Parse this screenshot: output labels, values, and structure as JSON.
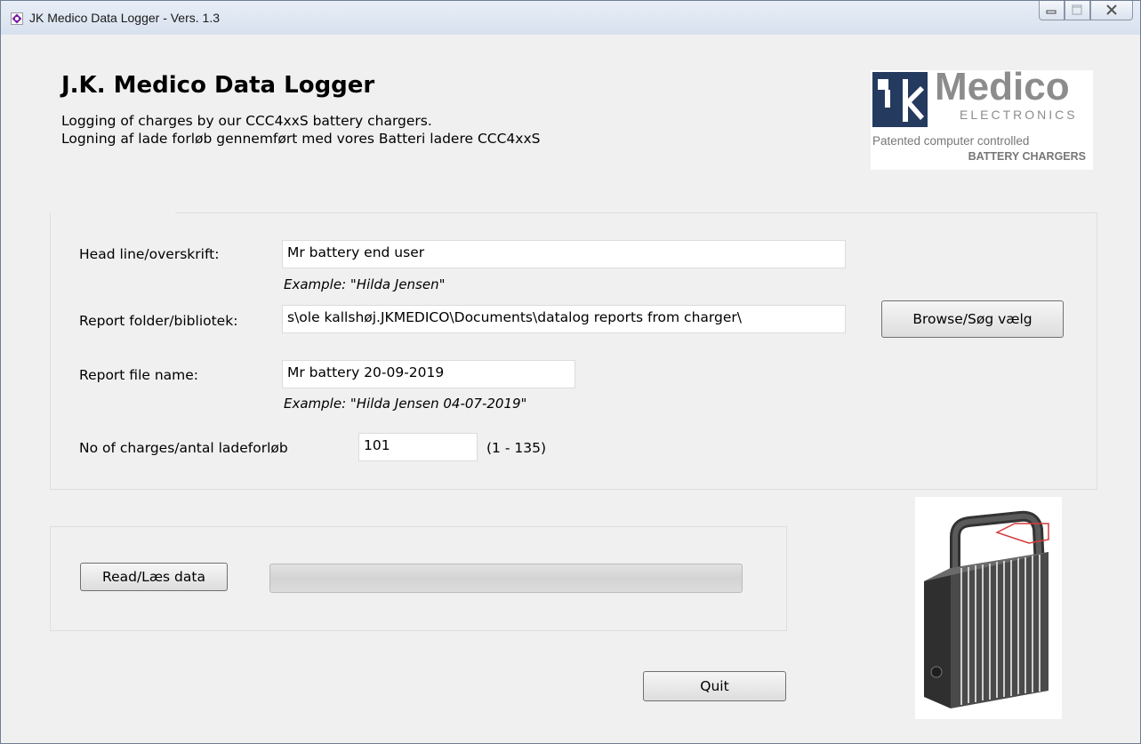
{
  "window": {
    "title": "JK Medico Data Logger - Vers. 1.3"
  },
  "header": {
    "title": "J.K. Medico Data Logger",
    "line1": "Logging of charges by our CCC4xxS battery chargers.",
    "line2": "Logning af lade forløb gennemført med vores Batteri ladere CCC4xxS"
  },
  "logo": {
    "brand": "Medico",
    "sub": "ELECTRONICS",
    "tagline1": "Patented computer controlled",
    "tagline2": "BATTERY CHARGERS"
  },
  "form": {
    "headline_label": "Head line/overskrift:",
    "headline_value": "Mr battery end user",
    "headline_example": "Example: \"Hilda Jensen\"",
    "folder_label": "Report folder/bibliotek:",
    "folder_value": "s\\ole kallshøj.JKMEDICO\\Documents\\datalog reports from charger\\",
    "browse_label": "Browse/Søg vælg",
    "filename_label": "Report file name:",
    "filename_value": "Mr battery 20-09-2019",
    "filename_example": "Example: \"Hilda Jensen 04-07-2019\"",
    "charges_label": "No of charges/antal ladeforløb",
    "charges_value": "101",
    "charges_range": "(1 - 135)"
  },
  "read": {
    "button_label": "Read/Læs data",
    "progress": 0
  },
  "quit_label": "Quit",
  "colors": {
    "logo_navy": "#243a5e",
    "logo_gray": "#8c8c8c",
    "accent": "#7a1fa2"
  }
}
